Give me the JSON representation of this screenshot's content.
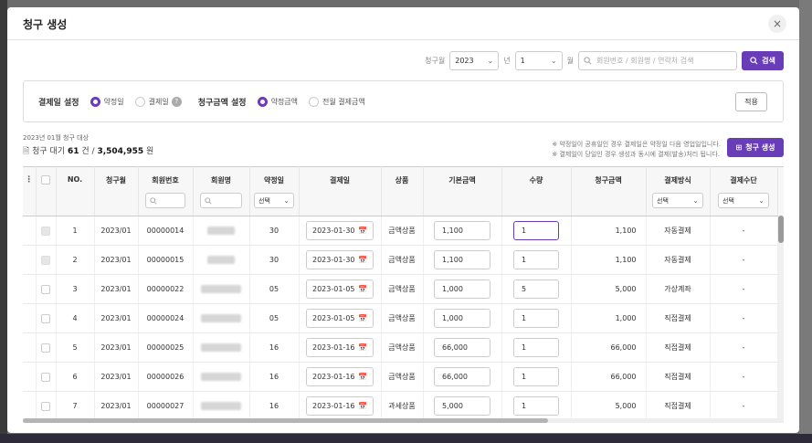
{
  "modal": {
    "title": "청구 생성",
    "close": "×"
  },
  "filter": {
    "month_label": "청구월",
    "year": "2023",
    "year_suffix": "년",
    "month": "1",
    "month_suffix": "월",
    "search_placeholder": "회원번호 / 회원명 / 연락처 검색",
    "search_button": "검색"
  },
  "settings": {
    "pay_date_label": "결제일 설정",
    "pay_date_options": [
      "약정일",
      "결제일"
    ],
    "amount_label": "청구금액 설정",
    "amount_options": [
      "약정금액",
      "전월 결제금액"
    ],
    "apply": "적용"
  },
  "summary": {
    "subtitle": "2023년 01월 청구 대상",
    "prefix": "청구 대기",
    "count": "61",
    "count_unit": "건 /",
    "total": "3,504,955",
    "total_unit": "원"
  },
  "notice": {
    "line1": "※ 약정일이 공휴일인 경우 결제일은 약정일 다음 영업일입니다.",
    "line2": "※ 결제일이 당일인 경우 생성과 동시에 결제(발송)처리 됩니다."
  },
  "create_button": "청구 생성",
  "table": {
    "headers": {
      "no": "NO.",
      "month": "청구월",
      "member_no": "회원번호",
      "member_name": "회원명",
      "contract_day": "약정일",
      "pay_date": "결제일",
      "product": "상품",
      "base_amount": "기본금액",
      "qty": "수량",
      "bill_amount": "청구금액",
      "pay_method": "결제방식",
      "pay_means": "결제수단"
    },
    "filter_select": "선택",
    "rows": [
      {
        "no": "1",
        "month": "2023/01",
        "member_no": "00000014",
        "day": "30",
        "date": "2023-01-30",
        "product": "금액상품",
        "base": "1,100",
        "qty": "1",
        "amount": "1,100",
        "method": "자동결제",
        "means": "-"
      },
      {
        "no": "2",
        "month": "2023/01",
        "member_no": "00000015",
        "day": "30",
        "date": "2023-01-30",
        "product": "금액상품",
        "base": "1,100",
        "qty": "1",
        "amount": "1,100",
        "method": "자동결제",
        "means": "-"
      },
      {
        "no": "3",
        "month": "2023/01",
        "member_no": "00000022",
        "day": "05",
        "date": "2023-01-05",
        "product": "금액상품",
        "base": "1,000",
        "qty": "5",
        "amount": "5,000",
        "method": "가상계좌",
        "means": "-"
      },
      {
        "no": "4",
        "month": "2023/01",
        "member_no": "00000024",
        "day": "05",
        "date": "2023-01-05",
        "product": "금액상품",
        "base": "1,000",
        "qty": "1",
        "amount": "1,000",
        "method": "직접결제",
        "means": "-"
      },
      {
        "no": "5",
        "month": "2023/01",
        "member_no": "00000025",
        "day": "16",
        "date": "2023-01-16",
        "product": "금액상품",
        "base": "66,000",
        "qty": "1",
        "amount": "66,000",
        "method": "직접결제",
        "means": "-"
      },
      {
        "no": "6",
        "month": "2023/01",
        "member_no": "00000026",
        "day": "16",
        "date": "2023-01-16",
        "product": "금액상품",
        "base": "66,000",
        "qty": "1",
        "amount": "66,000",
        "method": "직접결제",
        "means": "-"
      },
      {
        "no": "7",
        "month": "2023/01",
        "member_no": "00000027",
        "day": "16",
        "date": "2023-01-16",
        "product": "과세상품",
        "base": "5,000",
        "qty": "1",
        "amount": "5,000",
        "method": "직접결제",
        "means": "-"
      }
    ]
  }
}
